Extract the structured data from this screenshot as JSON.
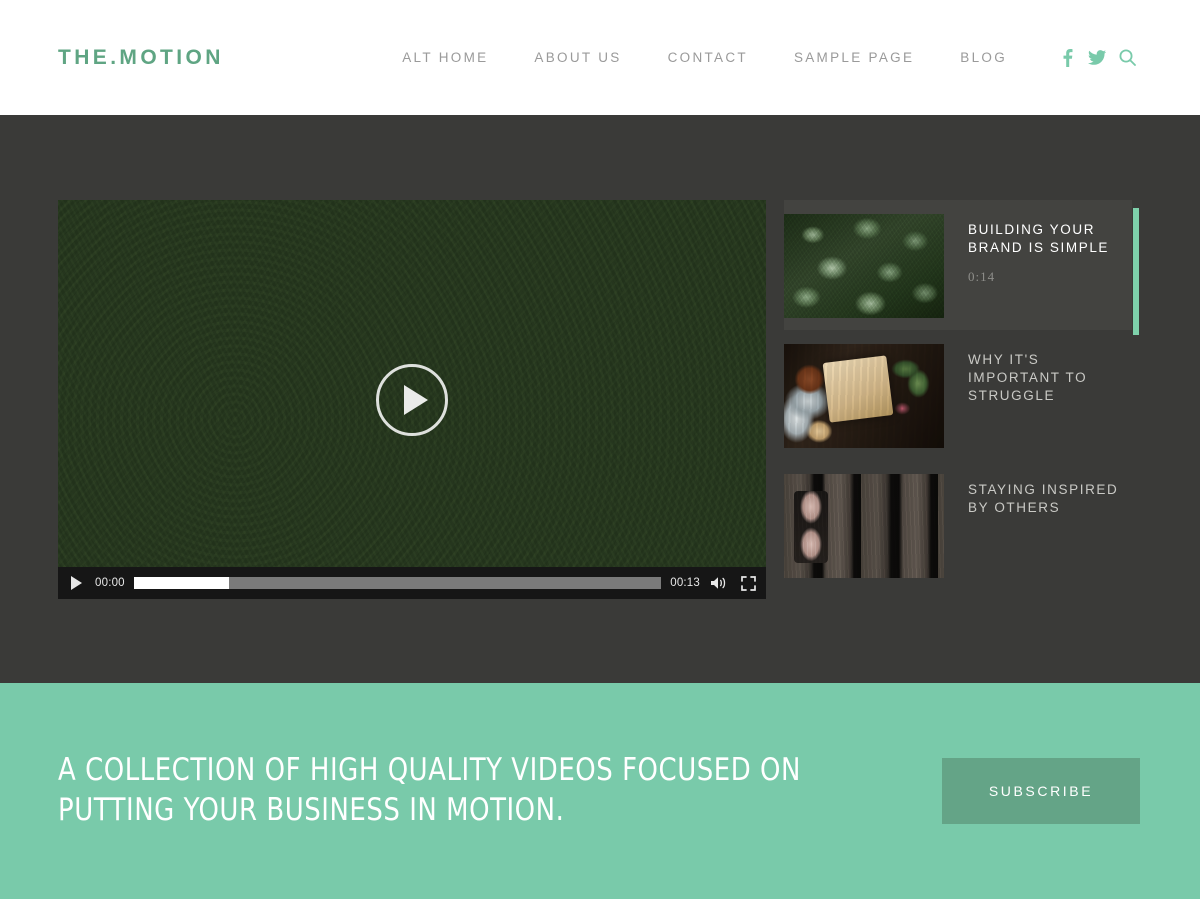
{
  "site": {
    "brand": "THE.MOTION",
    "accent_green": "#79caaa",
    "brand_green": "#5fa583",
    "dark_bg": "#3a3a38",
    "cta_button_green": "#64a487"
  },
  "header": {
    "nav_items": [
      {
        "label": "ALT HOME"
      },
      {
        "label": "ABOUT US"
      },
      {
        "label": "CONTACT"
      },
      {
        "label": "SAMPLE PAGE"
      },
      {
        "label": "BLOG"
      }
    ],
    "social": [
      {
        "name": "facebook-icon",
        "label": "Facebook"
      },
      {
        "name": "twitter-icon",
        "label": "Twitter"
      },
      {
        "name": "search-icon",
        "label": "Search"
      }
    ]
  },
  "player": {
    "poster_alt": "Overhead view of dense green succulent plants",
    "play_overlay_label": "Play",
    "controls": {
      "play_label": "Play",
      "current_time": "00:00",
      "duration": "00:13",
      "progress_percent": 18,
      "volume_label": "Mute",
      "fullscreen_label": "Fullscreen"
    }
  },
  "playlist": {
    "items": [
      {
        "title": "BUILDING YOUR BRAND IS SIMPLE",
        "duration": "0:14",
        "thumb": "succulent",
        "active": true
      },
      {
        "title": "WHY IT'S IMPORTANT TO STRUGGLE",
        "duration": "",
        "thumb": "flatlay",
        "active": false
      },
      {
        "title": "STAYING INSPIRED BY OTHERS",
        "duration": "",
        "thumb": "planks",
        "active": false
      }
    ],
    "scroll_thumb_color": "#7ed1ab"
  },
  "cta": {
    "headline": "A COLLECTION OF HIGH QUALITY VIDEOS FOCUSED ON PUTTING YOUR BUSINESS IN MOTION.",
    "button_label": "SUBSCRIBE"
  }
}
